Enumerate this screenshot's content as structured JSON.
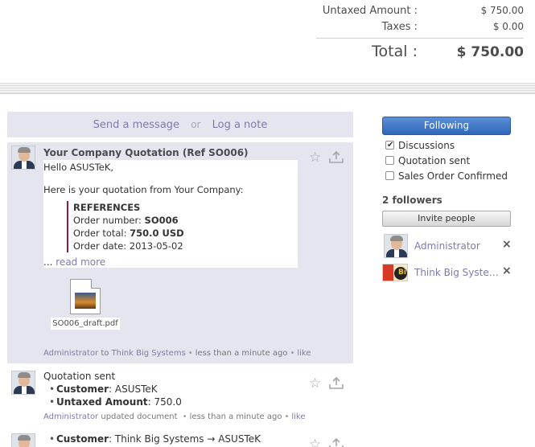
{
  "totals": {
    "untaxed_label": "Untaxed Amount :",
    "untaxed_value": "$ 750.00",
    "taxes_label": "Taxes :",
    "taxes_value": "$ 0.00",
    "total_label": "Total :",
    "total_value": "$ 750.00"
  },
  "compose": {
    "send_message": "Send a message",
    "or": "or",
    "log_note": "Log a note"
  },
  "messages": [
    {
      "title": "Your Company Quotation (Ref SO006)",
      "greeting": "Hello ASUSTeK,",
      "intro": "Here is your quotation from Your Company:",
      "ref_heading": "REFERENCES",
      "order_number_label": "Order number: ",
      "order_number_value": "SO006",
      "order_total_label": "Order total: ",
      "order_total_value": "750.0 USD",
      "order_date": "Order date: 2013-05-02",
      "ellipsis": "... ",
      "read_more": "read more",
      "attachment": "SO006_draft.pdf",
      "author": "Administrator",
      "to_word": " to ",
      "recipient": "Think Big Systems",
      "time": "less than a minute ago",
      "like": "like"
    },
    {
      "title": "Quotation sent",
      "f1_label": "Customer",
      "f1_value": ": ASUSTeK",
      "f2_label": "Untaxed Amount",
      "f2_value": ": 750.0",
      "author": "Administrator",
      "action": " updated document ",
      "time": "less than a minute ago",
      "like": "like"
    },
    {
      "f1_label": "Customer",
      "f1_value": ": Think Big Systems → ASUSTeK"
    }
  ],
  "sidebar": {
    "follow_button": "Following",
    "subtypes": [
      {
        "label": "Discussions",
        "checked": true
      },
      {
        "label": "Quotation sent",
        "checked": false
      },
      {
        "label": "Sales Order Confirmed",
        "checked": false
      }
    ],
    "followers_title": "2 followers",
    "invite_button": "Invite people",
    "followers": [
      {
        "name": "Administrator",
        "remove": "×"
      },
      {
        "name": "Think Big Systems",
        "remove": "×"
      }
    ],
    "logo_text": "Bi"
  },
  "icons": {
    "star": "☆"
  }
}
